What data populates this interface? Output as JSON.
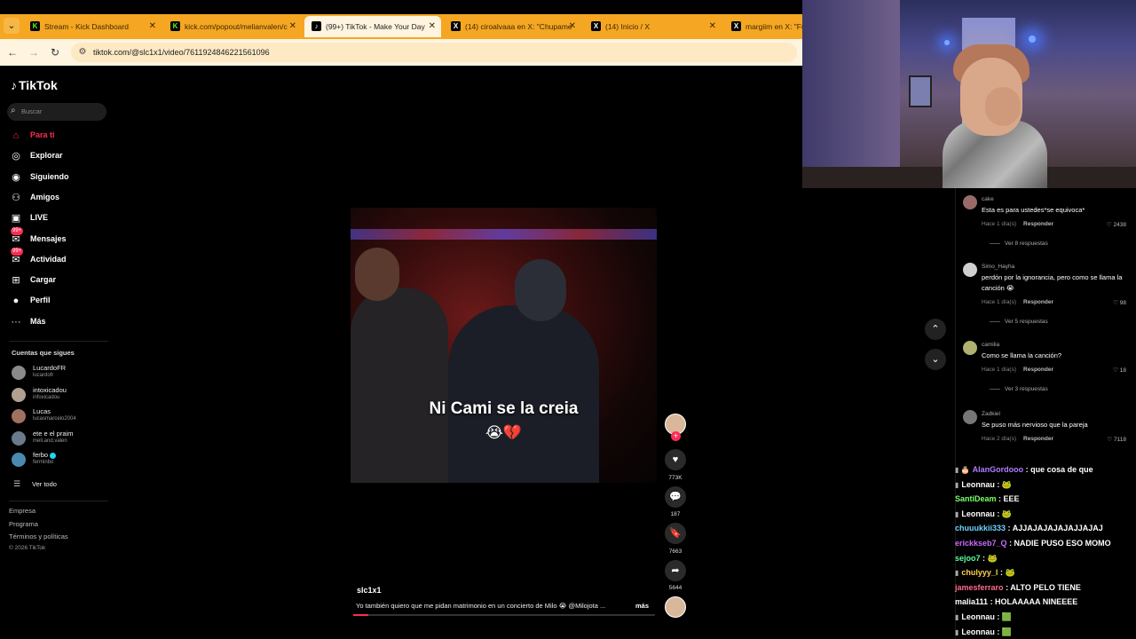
{
  "browser": {
    "tabs": [
      {
        "title": "Stream - Kick Dashboard",
        "favicon": "K",
        "type": "kick",
        "active": false
      },
      {
        "title": "kick.com/popout/melianvalen/c",
        "favicon": "K",
        "type": "kick",
        "active": false
      },
      {
        "title": "(99+) TikTok - Make Your Day",
        "favicon": "♪",
        "type": "tiktok",
        "active": true
      },
      {
        "title": "(14) ciroalvaaa en X: \"Chupame",
        "favicon": "X",
        "type": "x",
        "active": false
      },
      {
        "title": "(14) Inicio / X",
        "favicon": "X",
        "type": "x",
        "active": false
      },
      {
        "title": "margiim en X: \"Fu",
        "favicon": "X",
        "type": "x",
        "active": false
      }
    ],
    "url": "tiktok.com/@slc1x1/video/7611924846221561096",
    "accent": "#f5a623"
  },
  "tiktok": {
    "logo": "TikTok",
    "search_placeholder": "Buscar",
    "nav": [
      {
        "label": "Para ti",
        "icon": "home-icon",
        "active": true
      },
      {
        "label": "Explorar",
        "icon": "compass-icon",
        "active": false
      },
      {
        "label": "Siguiendo",
        "icon": "following-icon",
        "active": false
      },
      {
        "label": "Amigos",
        "icon": "friends-icon",
        "active": false
      },
      {
        "label": "LIVE",
        "icon": "live-icon",
        "active": false
      },
      {
        "label": "Mensajes",
        "icon": "messages-icon",
        "active": false,
        "badge": "99+"
      },
      {
        "label": "Actividad",
        "icon": "activity-icon",
        "active": false,
        "badge": "99+"
      },
      {
        "label": "Cargar",
        "icon": "upload-icon",
        "active": false
      },
      {
        "label": "Perfil",
        "icon": "profile-icon",
        "active": false
      },
      {
        "label": "Más",
        "icon": "more-icon",
        "active": false
      }
    ],
    "following_title": "Cuentas que sigues",
    "following": [
      {
        "name": "LucardoFR",
        "user": "lucardofr"
      },
      {
        "name": "intoxicadou",
        "user": "infoxicadou"
      },
      {
        "name": "Lucas",
        "user": "lucasmarcelo2004"
      },
      {
        "name": "ete e el praim",
        "user": "meli.and.valen"
      },
      {
        "name": "ferbo",
        "user": "ferminbo",
        "verified": true
      }
    ],
    "see_all": "Ver todo",
    "footer": [
      "Empresa",
      "Programa",
      "Términos y políticas"
    ],
    "copyright": "© 2026 TikTok",
    "video": {
      "caption": "Ni Cami se la creia",
      "caption_emojis": "😭💔",
      "author": "slc1x1",
      "description": "Yo también quiero que me pidan matrimonio en un concierto de Milo 😭 @Milojota ...",
      "more": "más",
      "progress": 0.05,
      "likes": "773K",
      "comments": "187",
      "saves": "7663",
      "shares": "5644"
    },
    "comments": [
      {
        "user": "cake",
        "text": "Esta es para ustedes*se equivoca*",
        "time": "Hace 1 día(s)",
        "reply": "Responder",
        "likes": "2438",
        "replies": "Ver 8 respuestas"
      },
      {
        "user": "Simo_Hayha",
        "text": "perdón por la ignorancia, pero como se llama la canción 😭",
        "time": "Hace 1 día(s)",
        "reply": "Responder",
        "likes": "98",
        "replies": "Ver 5 respuestas"
      },
      {
        "user": "camilia",
        "text": "Como se llama la canción?",
        "time": "Hace 1 día(s)",
        "reply": "Responder",
        "likes": "18",
        "replies": "Ver 3 respuestas"
      },
      {
        "user": "Zadkiel",
        "text": "Se puso más nervioso que la pareja",
        "time": "Hace 2 día(s)",
        "reply": "Responder",
        "likes": "7118"
      }
    ]
  },
  "chat": [
    {
      "user": "AlanGordooo",
      "msg": ": que cosa de que",
      "color": "#b07cff",
      "prefix": "▮ 🎂"
    },
    {
      "user": "Leonnau",
      "msg": ": 🐸",
      "color": "#ffffff",
      "prefix": "▮"
    },
    {
      "user": "SantiDeam",
      "msg": ": EEE",
      "color": "#7cff6b",
      "prefix": ""
    },
    {
      "user": "Leonnau",
      "msg": ": 🐸",
      "color": "#ffffff",
      "prefix": "▮"
    },
    {
      "user": "chuuukkii333",
      "msg": ": AJJAJAJAJAJAJJAJAJ",
      "color": "#6fd3ff",
      "prefix": ""
    },
    {
      "user": "erickkseb7_Q",
      "msg": ": NADIE PUSO ESO MOMO",
      "color": "#c76bff",
      "prefix": ""
    },
    {
      "user": "sejoo7",
      "msg": ": 🐸",
      "color": "#5cff9b",
      "prefix": ""
    },
    {
      "user": "chulyyy_l",
      "msg": ": 🐸",
      "color": "#ffd34d",
      "prefix": "▮"
    },
    {
      "user": "jamesferraro",
      "msg": ": ALTO PELO TIENE",
      "color": "#ff6b8a",
      "prefix": ""
    },
    {
      "user": "malia111",
      "msg": ": HOLAAAAA NINEEEE",
      "color": "#ffffff",
      "prefix": ""
    },
    {
      "user": "Leonnau",
      "msg": ": 🟩",
      "color": "#ffffff",
      "prefix": "▮"
    },
    {
      "user": "Leonnau",
      "msg": ": 🟩",
      "color": "#ffffff",
      "prefix": "▮"
    }
  ]
}
